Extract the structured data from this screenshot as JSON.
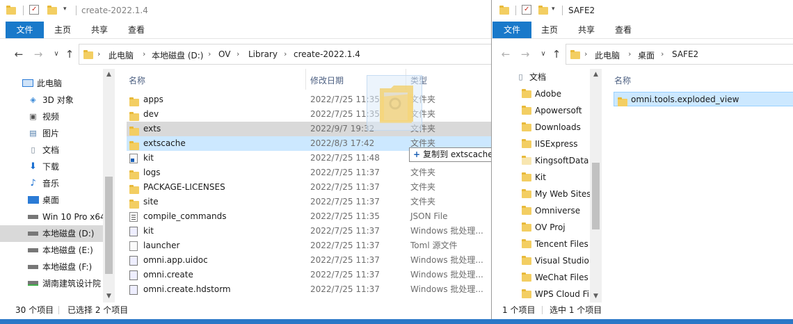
{
  "left_window": {
    "title": "create-2022.1.4",
    "ribbon_tabs": [
      "文件",
      "主页",
      "共享",
      "查看"
    ],
    "breadcrumb": [
      "此电脑",
      "本地磁盘 (D:)",
      "OV",
      "Library",
      "create-2022.1.4"
    ],
    "nav_items": [
      {
        "label": "此电脑",
        "icon": "computer-icon"
      },
      {
        "label": "3D 对象",
        "icon": "cube-icon"
      },
      {
        "label": "视频",
        "icon": "video-icon"
      },
      {
        "label": "图片",
        "icon": "picture-icon"
      },
      {
        "label": "文档",
        "icon": "document-icon"
      },
      {
        "label": "下载",
        "icon": "download-icon"
      },
      {
        "label": "音乐",
        "icon": "music-icon"
      },
      {
        "label": "桌面",
        "icon": "desktop-icon"
      },
      {
        "label": "Win 10 Pro x64",
        "icon": "drive-icon"
      },
      {
        "label": "本地磁盘 (D:)",
        "icon": "drive-icon"
      },
      {
        "label": "本地磁盘 (E:)",
        "icon": "drive-icon"
      },
      {
        "label": "本地磁盘 (F:)",
        "icon": "drive-icon"
      },
      {
        "label": "湖南建筑设计院",
        "icon": "network-drive-icon"
      }
    ],
    "columns": {
      "name": "名称",
      "date": "修改日期",
      "type": "类型"
    },
    "files": [
      {
        "name": "apps",
        "date": "2022/7/25 11:35",
        "type": "文件夹",
        "icon": "folder"
      },
      {
        "name": "dev",
        "date": "2022/7/25 11:35",
        "type": "文件夹",
        "icon": "folder"
      },
      {
        "name": "exts",
        "date": "2022/9/7 19:32",
        "type": "文件夹",
        "icon": "folder"
      },
      {
        "name": "extscache",
        "date": "2022/8/3 17:42",
        "type": "文件夹",
        "icon": "folder"
      },
      {
        "name": "kit",
        "date": "2022/7/25 11:48",
        "type": "",
        "icon": "shortcut"
      },
      {
        "name": "logs",
        "date": "2022/7/25 11:37",
        "type": "文件夹",
        "icon": "folder"
      },
      {
        "name": "PACKAGE-LICENSES",
        "date": "2022/7/25 11:37",
        "type": "文件夹",
        "icon": "folder"
      },
      {
        "name": "site",
        "date": "2022/7/25 11:37",
        "type": "文件夹",
        "icon": "folder"
      },
      {
        "name": "compile_commands",
        "date": "2022/7/25 11:35",
        "type": "JSON File",
        "icon": "json"
      },
      {
        "name": "kit",
        "date": "2022/7/25 11:37",
        "type": "Windows 批处理...",
        "icon": "batch"
      },
      {
        "name": "launcher",
        "date": "2022/7/25 11:37",
        "type": "Toml 源文件",
        "icon": "text"
      },
      {
        "name": "omni.app.uidoc",
        "date": "2022/7/25 11:37",
        "type": "Windows 批处理...",
        "icon": "batch"
      },
      {
        "name": "omni.create",
        "date": "2022/7/25 11:37",
        "type": "Windows 批处理...",
        "icon": "batch"
      },
      {
        "name": "omni.create.hdstorm",
        "date": "2022/7/25 11:37",
        "type": "Windows 批处理...",
        "icon": "batch"
      }
    ],
    "status": {
      "count": "30 个项目",
      "selected": "已选择 2 个项目"
    },
    "drag_tooltip": {
      "plus": "+",
      "text": "复制到 extscache"
    }
  },
  "right_window": {
    "title": "SAFE2",
    "ribbon_tabs": [
      "文件",
      "主页",
      "共享",
      "查看"
    ],
    "breadcrumb": [
      "此电脑",
      "桌面",
      "SAFE2"
    ],
    "nav_items": [
      {
        "label": "文档",
        "icon": "document-icon"
      },
      {
        "label": "Adobe",
        "icon": "folder"
      },
      {
        "label": "Apowersoft",
        "icon": "folder"
      },
      {
        "label": "Downloads",
        "icon": "folder"
      },
      {
        "label": "IISExpress",
        "icon": "folder"
      },
      {
        "label": "KingsoftData",
        "icon": "folder-light"
      },
      {
        "label": "Kit",
        "icon": "folder"
      },
      {
        "label": "My Web Sites",
        "icon": "folder"
      },
      {
        "label": "Omniverse",
        "icon": "folder"
      },
      {
        "label": "OV Proj",
        "icon": "folder"
      },
      {
        "label": "Tencent Files",
        "icon": "folder"
      },
      {
        "label": "Visual Studio",
        "icon": "folder"
      },
      {
        "label": "WeChat Files",
        "icon": "folder"
      },
      {
        "label": "WPS Cloud Fi",
        "icon": "folder"
      }
    ],
    "columns": {
      "name": "名称"
    },
    "files": [
      {
        "name": "omni.tools.exploded_view",
        "icon": "folder"
      }
    ],
    "status": {
      "count": "1 个项目",
      "selected": "选中 1 个项目"
    }
  },
  "colors": {
    "accent": "#1979ca",
    "selection": "#cce8ff",
    "hover": "#d9d9d9",
    "folder": "#f3ce62",
    "taskbar": "#2a78c7"
  }
}
